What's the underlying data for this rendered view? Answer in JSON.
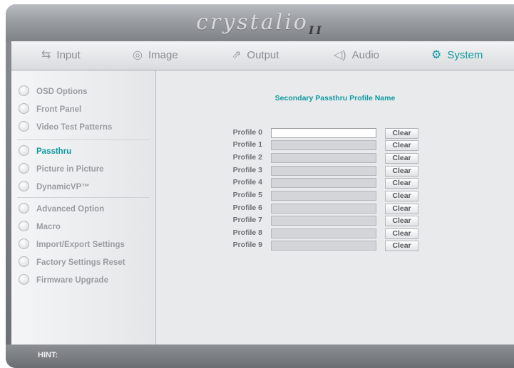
{
  "brand": {
    "logo": "crystalio",
    "logo_mark": "II"
  },
  "tabs": [
    {
      "label": "Input",
      "icon": "input-icon",
      "glyph": "⇆"
    },
    {
      "label": "Image",
      "icon": "eye-icon",
      "glyph": "◎"
    },
    {
      "label": "Output",
      "icon": "output-icon",
      "glyph": "⇗"
    },
    {
      "label": "Audio",
      "icon": "speaker-icon",
      "glyph": "◁)"
    },
    {
      "label": "System",
      "icon": "gear-icon",
      "glyph": "⚙"
    }
  ],
  "active_tab": "System",
  "sidebar": {
    "items": [
      {
        "label": "OSD Options"
      },
      {
        "label": "Front Panel"
      },
      {
        "label": "Video Test Patterns"
      },
      {
        "label": "Passthru"
      },
      {
        "label": "Picture in Picture"
      },
      {
        "label": "DynamicVP™"
      },
      {
        "label": "Advanced Option"
      },
      {
        "label": "Macro"
      },
      {
        "label": "Import/Export Settings"
      },
      {
        "label": "Factory Settings Reset"
      },
      {
        "label": "Firmware Upgrade"
      }
    ],
    "active": "Passthru"
  },
  "main": {
    "title": "Secondary Passthru Profile Name",
    "clear_label": "Clear",
    "profiles": [
      {
        "label": "Profile 0",
        "value": ""
      },
      {
        "label": "Profile 1",
        "value": ""
      },
      {
        "label": "Profile 2",
        "value": ""
      },
      {
        "label": "Profile 3",
        "value": ""
      },
      {
        "label": "Profile 4",
        "value": ""
      },
      {
        "label": "Profile 5",
        "value": ""
      },
      {
        "label": "Profile 6",
        "value": ""
      },
      {
        "label": "Profile 7",
        "value": ""
      },
      {
        "label": "Profile 8",
        "value": ""
      },
      {
        "label": "Profile 9",
        "value": ""
      }
    ]
  },
  "hint": {
    "label": "HINT:"
  },
  "colors": {
    "accent": "#0e9aa0",
    "frame": "#7f8287",
    "panel": "#e8eaec"
  }
}
